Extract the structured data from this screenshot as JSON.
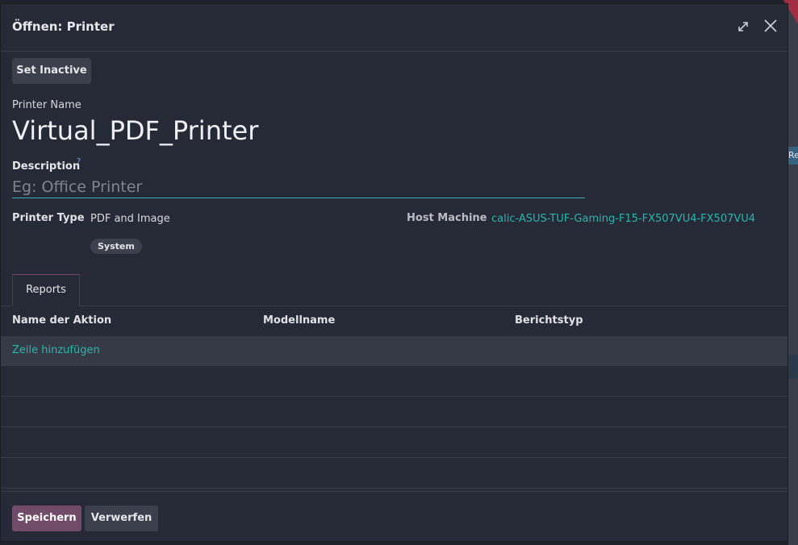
{
  "modal": {
    "title": "Öffnen: Printer",
    "set_inactive_label": "Set Inactive",
    "printer_name_label": "Printer Name",
    "printer_name_value": "Virtual_PDF_Printer",
    "description_label": "Description",
    "description_help": "?",
    "description_placeholder": "Eg: Office Printer",
    "printer_type_label": "Printer Type",
    "printer_type_value": "PDF and Image",
    "printer_type_badge": "System",
    "host_machine_label": "Host Machine",
    "host_machine_value": "calic-ASUS-TUF-Gaming-F15-FX507VU4-FX507VU4"
  },
  "tabs": [
    {
      "label": "Reports"
    }
  ],
  "table": {
    "columns": [
      "Name der Aktion",
      "Modellname",
      "Berichtstyp"
    ],
    "add_row_label": "Zeile hinzufügen"
  },
  "footer": {
    "save_label": "Speichern",
    "discard_label": "Verwerfen"
  },
  "background": {
    "tag_text": "Re"
  },
  "colors": {
    "primary": "#714b67",
    "link": "#27b6b0",
    "background": "#262a36"
  }
}
